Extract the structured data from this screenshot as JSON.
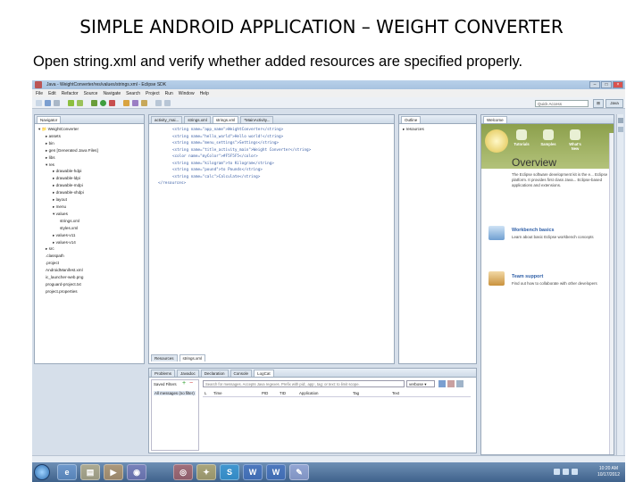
{
  "slide": {
    "title": "SIMPLE ANDROID APPLICATION – WEIGHT CONVERTER",
    "subtitle": "Open string.xml and verify whether added resources are specified properly."
  },
  "window": {
    "title": "Java - WeightConverter/res/values/strings.xml - Eclipse SDK"
  },
  "menu": [
    "File",
    "Edit",
    "Refactor",
    "Source",
    "Navigate",
    "Search",
    "Project",
    "Run",
    "Window",
    "Help"
  ],
  "toolbar": {
    "quick_access_placeholder": "Quick Access",
    "perspective_java": "Java"
  },
  "navigator": {
    "tab": "Navigator",
    "items": [
      "WeightConverter",
      "assets",
      "bin",
      "gen [Generated Java Files]",
      "libs",
      "res",
      "drawable-hdpi",
      "drawable-ldpi",
      "drawable-mdpi",
      "drawable-xhdpi",
      "layout",
      "menu",
      "values",
      "strings.xml",
      "styles.xml",
      "values-v11",
      "values-v14",
      "src",
      ".classpath",
      ".project",
      "AndroidManifest.xml",
      "ic_launcher-web.png",
      "proguard-project.txt",
      "project.properties"
    ]
  },
  "editor": {
    "tabs": [
      "activity_mai...",
      "strings.xml",
      "strings.xml",
      "*MainActivity..."
    ],
    "code_lines": [
      "<string name=\"app_name\">WeightConverter</string>",
      "<string name=\"hello_world\">Hello world!</string>",
      "<string name=\"menu_settings\">Settings</string>",
      "<string name=\"title_activity_main\">Weight Converter</string>",
      "<color name=\"myColor\">#F5F5F5</color>",
      "<string name=\"kilogram\">to Kilogram</string>",
      "<string name=\"pound\">to Pounds</string>",
      "<string name=\"calc\">Calculate</string>",
      "",
      "</resources>"
    ],
    "bottom_tabs": [
      "Resources",
      "strings.xml"
    ]
  },
  "outline": {
    "tab": "Outline",
    "items": [
      "resources"
    ]
  },
  "welcome": {
    "tab": "Welcome",
    "icons": [
      "Tutorials",
      "Samples",
      "What's New"
    ],
    "overview_title": "Overview",
    "overview_text": "The Eclipse software development kit is the e... Eclipse platform. It provides first class Java... Eclipse-based applications and extensions.",
    "sections": [
      {
        "title": "Workbench basics",
        "text": "Learn about basic Eclipse workbench concepts"
      },
      {
        "title": "Team support",
        "text": "Find out how to collaborate with other developers"
      }
    ]
  },
  "console": {
    "tabs": [
      "Problems",
      "Javadoc",
      "Declaration",
      "Console",
      "LogCat"
    ],
    "saved_filters_label": "Saved Filters",
    "filter_item": "All messages (no filter)",
    "search_placeholder": "Search for messages. Accepts Java regexes. Prefix with pid:, app:, tag: or text: to limit scope.",
    "level": "verbose",
    "columns": [
      "L",
      "Time",
      "PID",
      "TID",
      "Application",
      "Tag",
      "Text"
    ]
  },
  "taskbar": {
    "time": "10:20 AM",
    "date": "10/17/2012",
    "apps": [
      "W",
      "S",
      "W"
    ]
  }
}
